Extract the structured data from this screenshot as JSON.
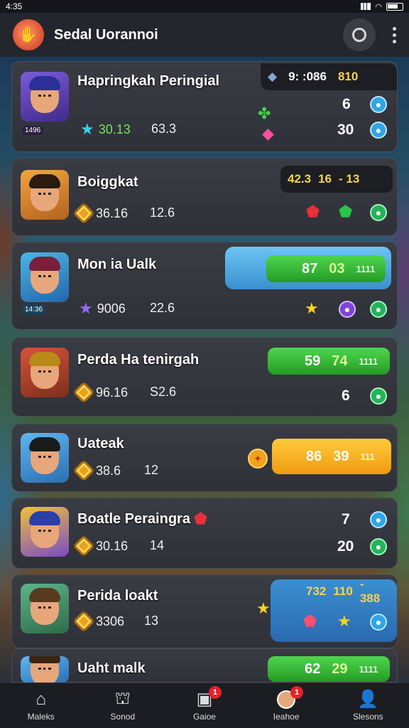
{
  "status": {
    "time": "4:35"
  },
  "header": {
    "title": "Sedal Uorannoi"
  },
  "colors": {
    "green": "#36c236",
    "orange": "#f5ad1d",
    "blue": "#4aa7e3",
    "card": "#34363d"
  },
  "entries": [
    {
      "name": "Hapringkah Peringial",
      "level": "1496",
      "stat_a": "30.13",
      "stat_b": "63.3",
      "score": "9: :086",
      "score_alt": "810",
      "r1": "6",
      "r2": "30"
    },
    {
      "name": "Boiggkat",
      "stat_a": "36.16",
      "stat_b": "12.6",
      "score": "42.3",
      "score_mid": "16",
      "score_alt": "- 13",
      "r1": "",
      "r2": ""
    },
    {
      "name": "Mon ia Ualk",
      "level": "14:36",
      "stat_a": "9006",
      "stat_b": "22.6",
      "score": "87",
      "score_alt": "03",
      "score_small": "1111"
    },
    {
      "name": "Perda Ha tenirgah",
      "stat_a": "96.16",
      "stat_b": "S2.6",
      "score": "59",
      "score_alt": "74",
      "score_small": "1111",
      "r1": "6"
    },
    {
      "name": "Uateak",
      "stat_a": "38.6",
      "stat_b": "12",
      "score": "86",
      "score_alt": "39",
      "score_small": "111"
    },
    {
      "name": "Boatle Peraingra",
      "stat_a": "30.16",
      "stat_b": "14",
      "r1": "7",
      "r2": "20"
    },
    {
      "name": "Perida loakt",
      "stat_a": "3306",
      "stat_b": "13",
      "score": "732",
      "score_mid": "110",
      "score_alt": "- 388"
    },
    {
      "name": "Uaht malk",
      "score": "62",
      "score_alt": "29",
      "score_small": "1111"
    }
  ],
  "tabs": [
    {
      "label": "Maleks",
      "icon": "home-icon"
    },
    {
      "label": "Sonod",
      "icon": "shop-icon"
    },
    {
      "label": "Gaioe",
      "icon": "gift-icon",
      "badge": "1"
    },
    {
      "label": "Ieahoe",
      "icon": "profile-icon",
      "badge": "1"
    },
    {
      "label": "Slesons",
      "icon": "person-icon"
    }
  ]
}
